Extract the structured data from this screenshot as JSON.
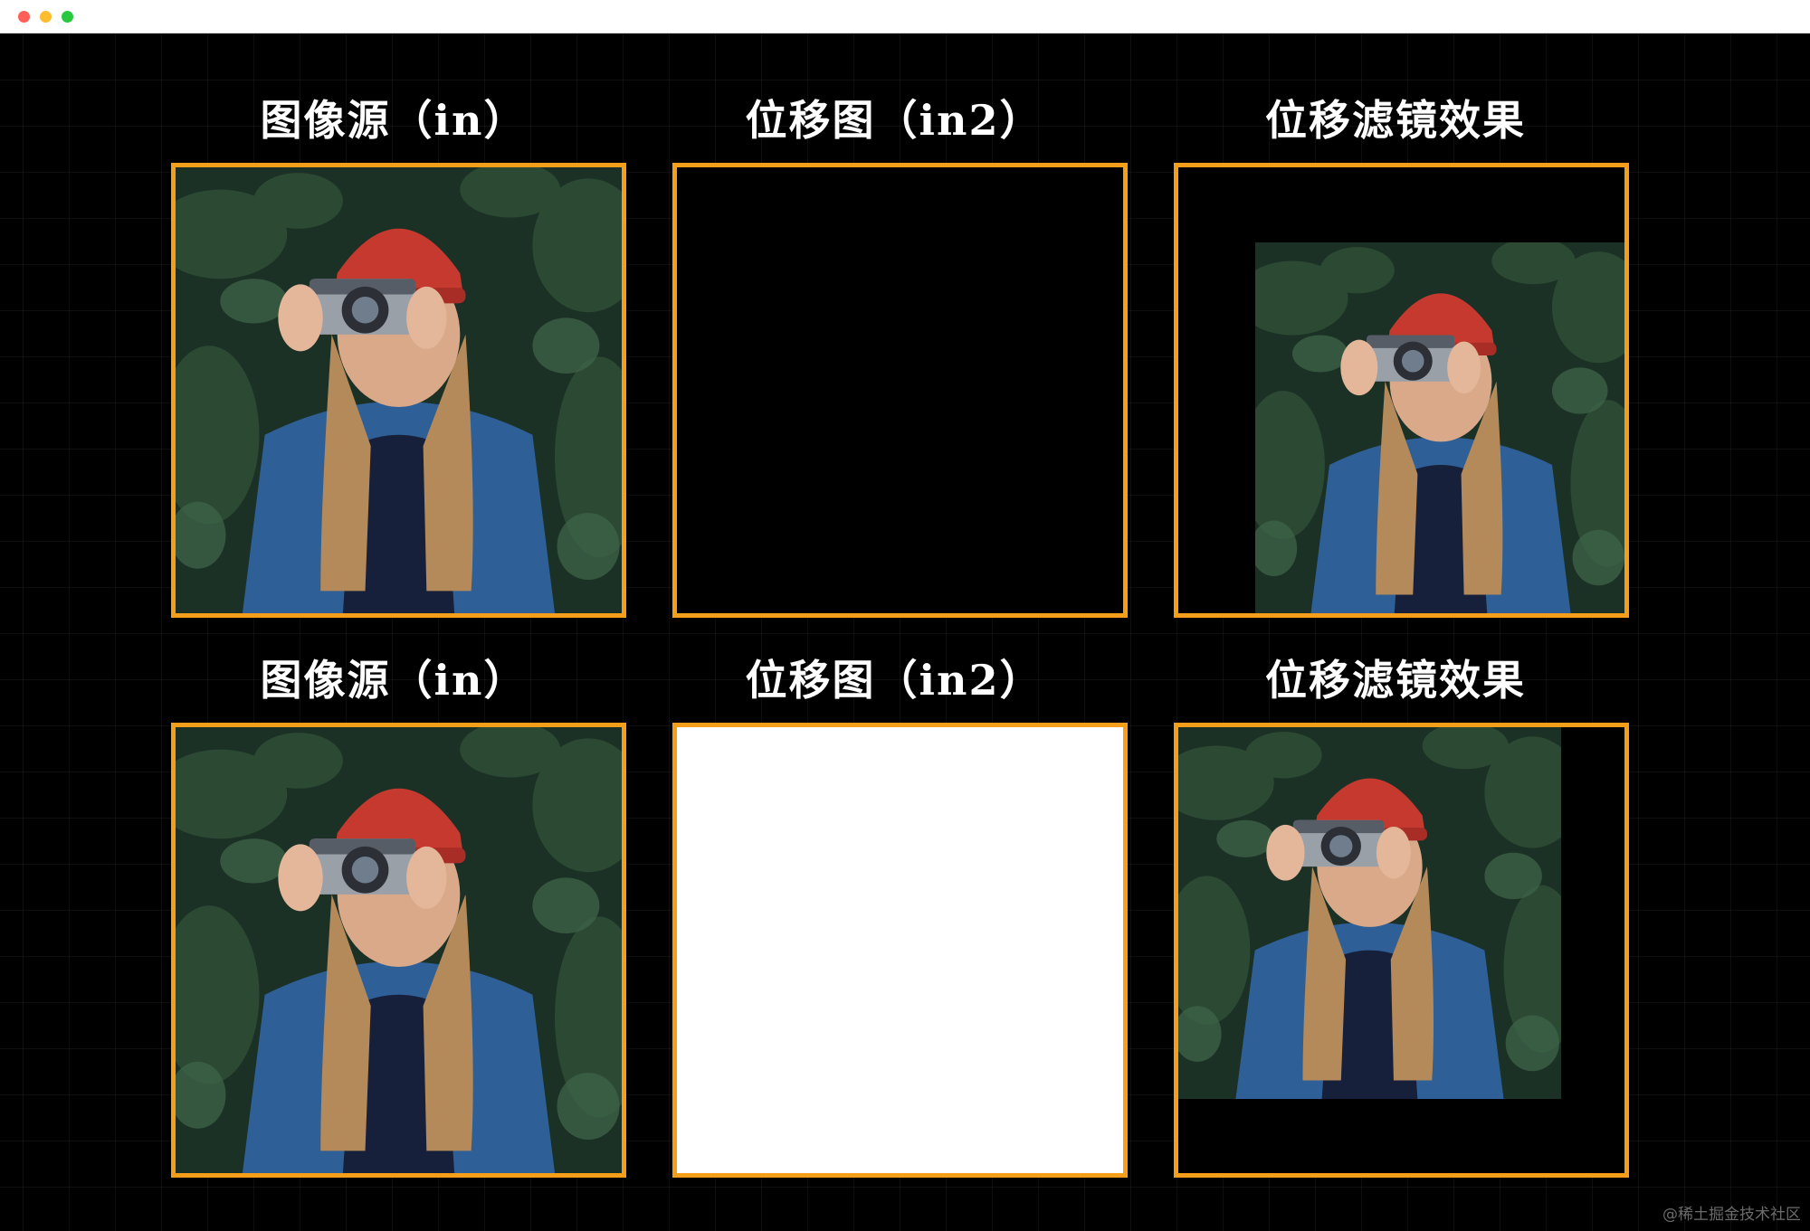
{
  "window": {
    "traffic_lights": [
      "close",
      "minimize",
      "maximize"
    ]
  },
  "colors": {
    "frame_border": "#f59e1a",
    "background": "#000000",
    "title_text": "#ffffff"
  },
  "rows": [
    {
      "labels": {
        "source": "图像源（in）",
        "map": "位移图（in2）",
        "result": "位移滤镜效果"
      },
      "map_fill": "black"
    },
    {
      "labels": {
        "source": "图像源（in）",
        "map": "位移图（in2）",
        "result": "位移滤镜效果"
      },
      "map_fill": "white"
    }
  ],
  "watermark": "@稀土掘金技术社区"
}
